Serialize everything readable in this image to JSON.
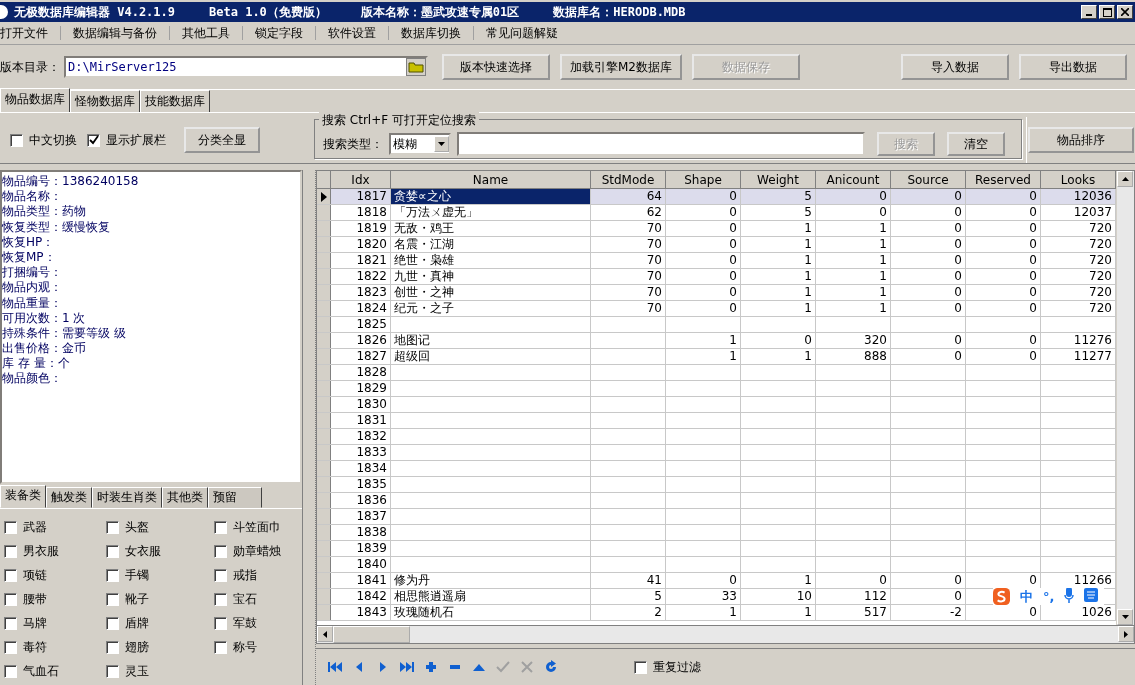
{
  "window": {
    "title_parts": [
      "无极数据库编辑器 V4.2.1.9",
      "Beta 1.0（免费版）",
      "版本名称：墨武攻速专属01区",
      "数据库名：HERODB.MDB"
    ]
  },
  "menu": [
    "打开文件",
    "数据编辑与备份",
    "其他工具",
    "锁定字段",
    "软件设置",
    "数据库切换",
    "常见问题解疑"
  ],
  "toolbar": {
    "path_label": "版本目录：",
    "path_value": "D:\\MirServer125",
    "buttons": [
      {
        "label": "版本快速选择",
        "disabled": false
      },
      {
        "label": "加载引擎M2数据库",
        "disabled": false
      },
      {
        "label": "数据保存",
        "disabled": true
      }
    ],
    "right_buttons": [
      {
        "label": "导入数据",
        "disabled": false
      },
      {
        "label": "导出数据",
        "disabled": false
      }
    ]
  },
  "db_tabs": [
    {
      "label": "物品数据库",
      "selected": true
    },
    {
      "label": "怪物数据库",
      "selected": false
    },
    {
      "label": "技能数据库",
      "selected": false
    }
  ],
  "options": {
    "checkboxes": [
      {
        "label": "中文切换",
        "checked": false
      },
      {
        "label": "显示扩展栏",
        "checked": true
      }
    ],
    "show_all_button": "分类全显"
  },
  "search": {
    "group_title": "搜索  Ctrl+F 可打开定位搜索",
    "type_label": "搜索类型：",
    "type_value": "模糊",
    "search_button": {
      "label": "搜索",
      "disabled": true
    },
    "clear_button": "清空"
  },
  "sort_button": "物品排序",
  "item_info": [
    "物品编号：1386240158",
    "物品名称：",
    "物品类型：药物",
    "恢复类型：缓慢恢复",
    "恢复HP：",
    "恢复MP：",
    "打捆编号：",
    "物品内观：",
    "物品重量：",
    "可用次数：1 次",
    "持殊条件：需要等级  级",
    "出售价格：金币",
    "库 存 量：个",
    "物品颜色："
  ],
  "category_tabs": [
    {
      "label": "装备类",
      "selected": true
    },
    {
      "label": "触发类",
      "selected": false
    },
    {
      "label": "时装生肖类",
      "selected": false
    },
    {
      "label": "其他类",
      "selected": false
    },
    {
      "label": "预留",
      "selected": false
    }
  ],
  "categories": [
    {
      "label": "武器",
      "checked": false
    },
    {
      "label": "头盔",
      "checked": false
    },
    {
      "label": "斗笠面巾",
      "checked": false
    },
    {
      "label": "男衣服",
      "checked": false
    },
    {
      "label": "女衣服",
      "checked": false
    },
    {
      "label": "勋章蜡烛",
      "checked": false
    },
    {
      "label": "项链",
      "checked": false
    },
    {
      "label": "手镯",
      "checked": false
    },
    {
      "label": "戒指",
      "checked": false
    },
    {
      "label": "腰带",
      "checked": false
    },
    {
      "label": "靴子",
      "checked": false
    },
    {
      "label": "宝石",
      "checked": false
    },
    {
      "label": "马牌",
      "checked": false
    },
    {
      "label": "盾牌",
      "checked": false
    },
    {
      "label": "军鼓",
      "checked": false
    },
    {
      "label": "毒符",
      "checked": false
    },
    {
      "label": "翅膀",
      "checked": false
    },
    {
      "label": "称号",
      "checked": false
    },
    {
      "label": "气血石",
      "checked": false
    },
    {
      "label": "灵玉",
      "checked": false
    }
  ],
  "table": {
    "columns": [
      "Idx",
      "Name",
      "StdMode",
      "Shape",
      "Weight",
      "Anicount",
      "Source",
      "Reserved",
      "Looks"
    ],
    "rows": [
      {
        "selected": true,
        "cells": [
          "1817",
          "贪婪∝之心",
          "64",
          "0",
          "5",
          "0",
          "0",
          "0",
          "12036"
        ]
      },
      {
        "selected": false,
        "cells": [
          "1818",
          "「万法ㄨ虚无」",
          "62",
          "0",
          "5",
          "0",
          "0",
          "0",
          "12037"
        ]
      },
      {
        "selected": false,
        "cells": [
          "1819",
          "无敌・鸡王",
          "70",
          "0",
          "1",
          "1",
          "0",
          "0",
          "720"
        ]
      },
      {
        "selected": false,
        "cells": [
          "1820",
          "名震・江湖",
          "70",
          "0",
          "1",
          "1",
          "0",
          "0",
          "720"
        ]
      },
      {
        "selected": false,
        "cells": [
          "1821",
          "绝世・枭雄",
          "70",
          "0",
          "1",
          "1",
          "0",
          "0",
          "720"
        ]
      },
      {
        "selected": false,
        "cells": [
          "1822",
          "九世・真神",
          "70",
          "0",
          "1",
          "1",
          "0",
          "0",
          "720"
        ]
      },
      {
        "selected": false,
        "cells": [
          "1823",
          "创世・之神",
          "70",
          "0",
          "1",
          "1",
          "0",
          "0",
          "720"
        ]
      },
      {
        "selected": false,
        "cells": [
          "1824",
          "纪元・之子",
          "70",
          "0",
          "1",
          "1",
          "0",
          "0",
          "720"
        ]
      },
      {
        "selected": false,
        "cells": [
          "1825",
          null,
          null,
          null,
          null,
          null,
          null,
          null,
          null
        ]
      },
      {
        "selected": false,
        "cells": [
          "1826",
          "地图记",
          null,
          "1",
          "0",
          "320",
          "0",
          "0",
          "11276"
        ]
      },
      {
        "selected": false,
        "cells": [
          "1827",
          "超级回",
          null,
          "1",
          "1",
          "888",
          "0",
          "0",
          "11277"
        ]
      },
      {
        "selected": false,
        "cells": [
          "1828",
          null,
          null,
          null,
          null,
          null,
          null,
          null,
          null
        ]
      },
      {
        "selected": false,
        "cells": [
          "1829",
          null,
          null,
          null,
          null,
          null,
          null,
          null,
          null
        ]
      },
      {
        "selected": false,
        "cells": [
          "1830",
          null,
          null,
          null,
          null,
          null,
          null,
          null,
          null
        ]
      },
      {
        "selected": false,
        "cells": [
          "1831",
          null,
          null,
          null,
          null,
          null,
          null,
          null,
          null
        ]
      },
      {
        "selected": false,
        "cells": [
          "1832",
          null,
          null,
          null,
          null,
          null,
          null,
          null,
          null
        ]
      },
      {
        "selected": false,
        "cells": [
          "1833",
          null,
          null,
          null,
          null,
          null,
          null,
          null,
          null
        ]
      },
      {
        "selected": false,
        "cells": [
          "1834",
          null,
          null,
          null,
          null,
          null,
          null,
          null,
          null
        ]
      },
      {
        "selected": false,
        "cells": [
          "1835",
          null,
          null,
          null,
          null,
          null,
          null,
          null,
          null
        ]
      },
      {
        "selected": false,
        "cells": [
          "1836",
          null,
          null,
          null,
          null,
          null,
          null,
          null,
          null
        ]
      },
      {
        "selected": false,
        "cells": [
          "1837",
          null,
          null,
          null,
          null,
          null,
          null,
          null,
          null
        ]
      },
      {
        "selected": false,
        "cells": [
          "1838",
          null,
          null,
          null,
          null,
          null,
          null,
          null,
          null
        ]
      },
      {
        "selected": false,
        "cells": [
          "1839",
          null,
          null,
          null,
          null,
          null,
          null,
          null,
          null
        ]
      },
      {
        "selected": false,
        "cells": [
          "1840",
          null,
          null,
          null,
          null,
          null,
          null,
          null,
          null
        ]
      },
      {
        "selected": false,
        "cells": [
          "1841",
          "修为丹",
          "41",
          "0",
          "1",
          "0",
          "0",
          "0",
          "11266"
        ]
      },
      {
        "selected": false,
        "cells": [
          "1842",
          "相思熊逍遥扇",
          "5",
          "33",
          "10",
          "112",
          "0",
          null,
          null
        ]
      },
      {
        "selected": false,
        "cells": [
          "1843",
          "玫瑰随机石",
          "2",
          "1",
          "1",
          "517",
          "-2",
          "0",
          "1026"
        ]
      }
    ]
  },
  "navigator": [
    {
      "kind": "first",
      "disabled": false
    },
    {
      "kind": "prior",
      "disabled": false
    },
    {
      "kind": "next",
      "disabled": false
    },
    {
      "kind": "last",
      "disabled": false
    },
    {
      "kind": "insert",
      "disabled": false
    },
    {
      "kind": "delete",
      "disabled": false
    },
    {
      "kind": "edit",
      "disabled": false
    },
    {
      "kind": "post",
      "disabled": true
    },
    {
      "kind": "cancel",
      "disabled": true
    },
    {
      "kind": "refresh",
      "disabled": false
    }
  ],
  "filter_checkbox": {
    "label": "重复过滤",
    "checked": false
  },
  "ime_toolbar": {
    "mode": "中",
    "punctuation": "°,"
  }
}
